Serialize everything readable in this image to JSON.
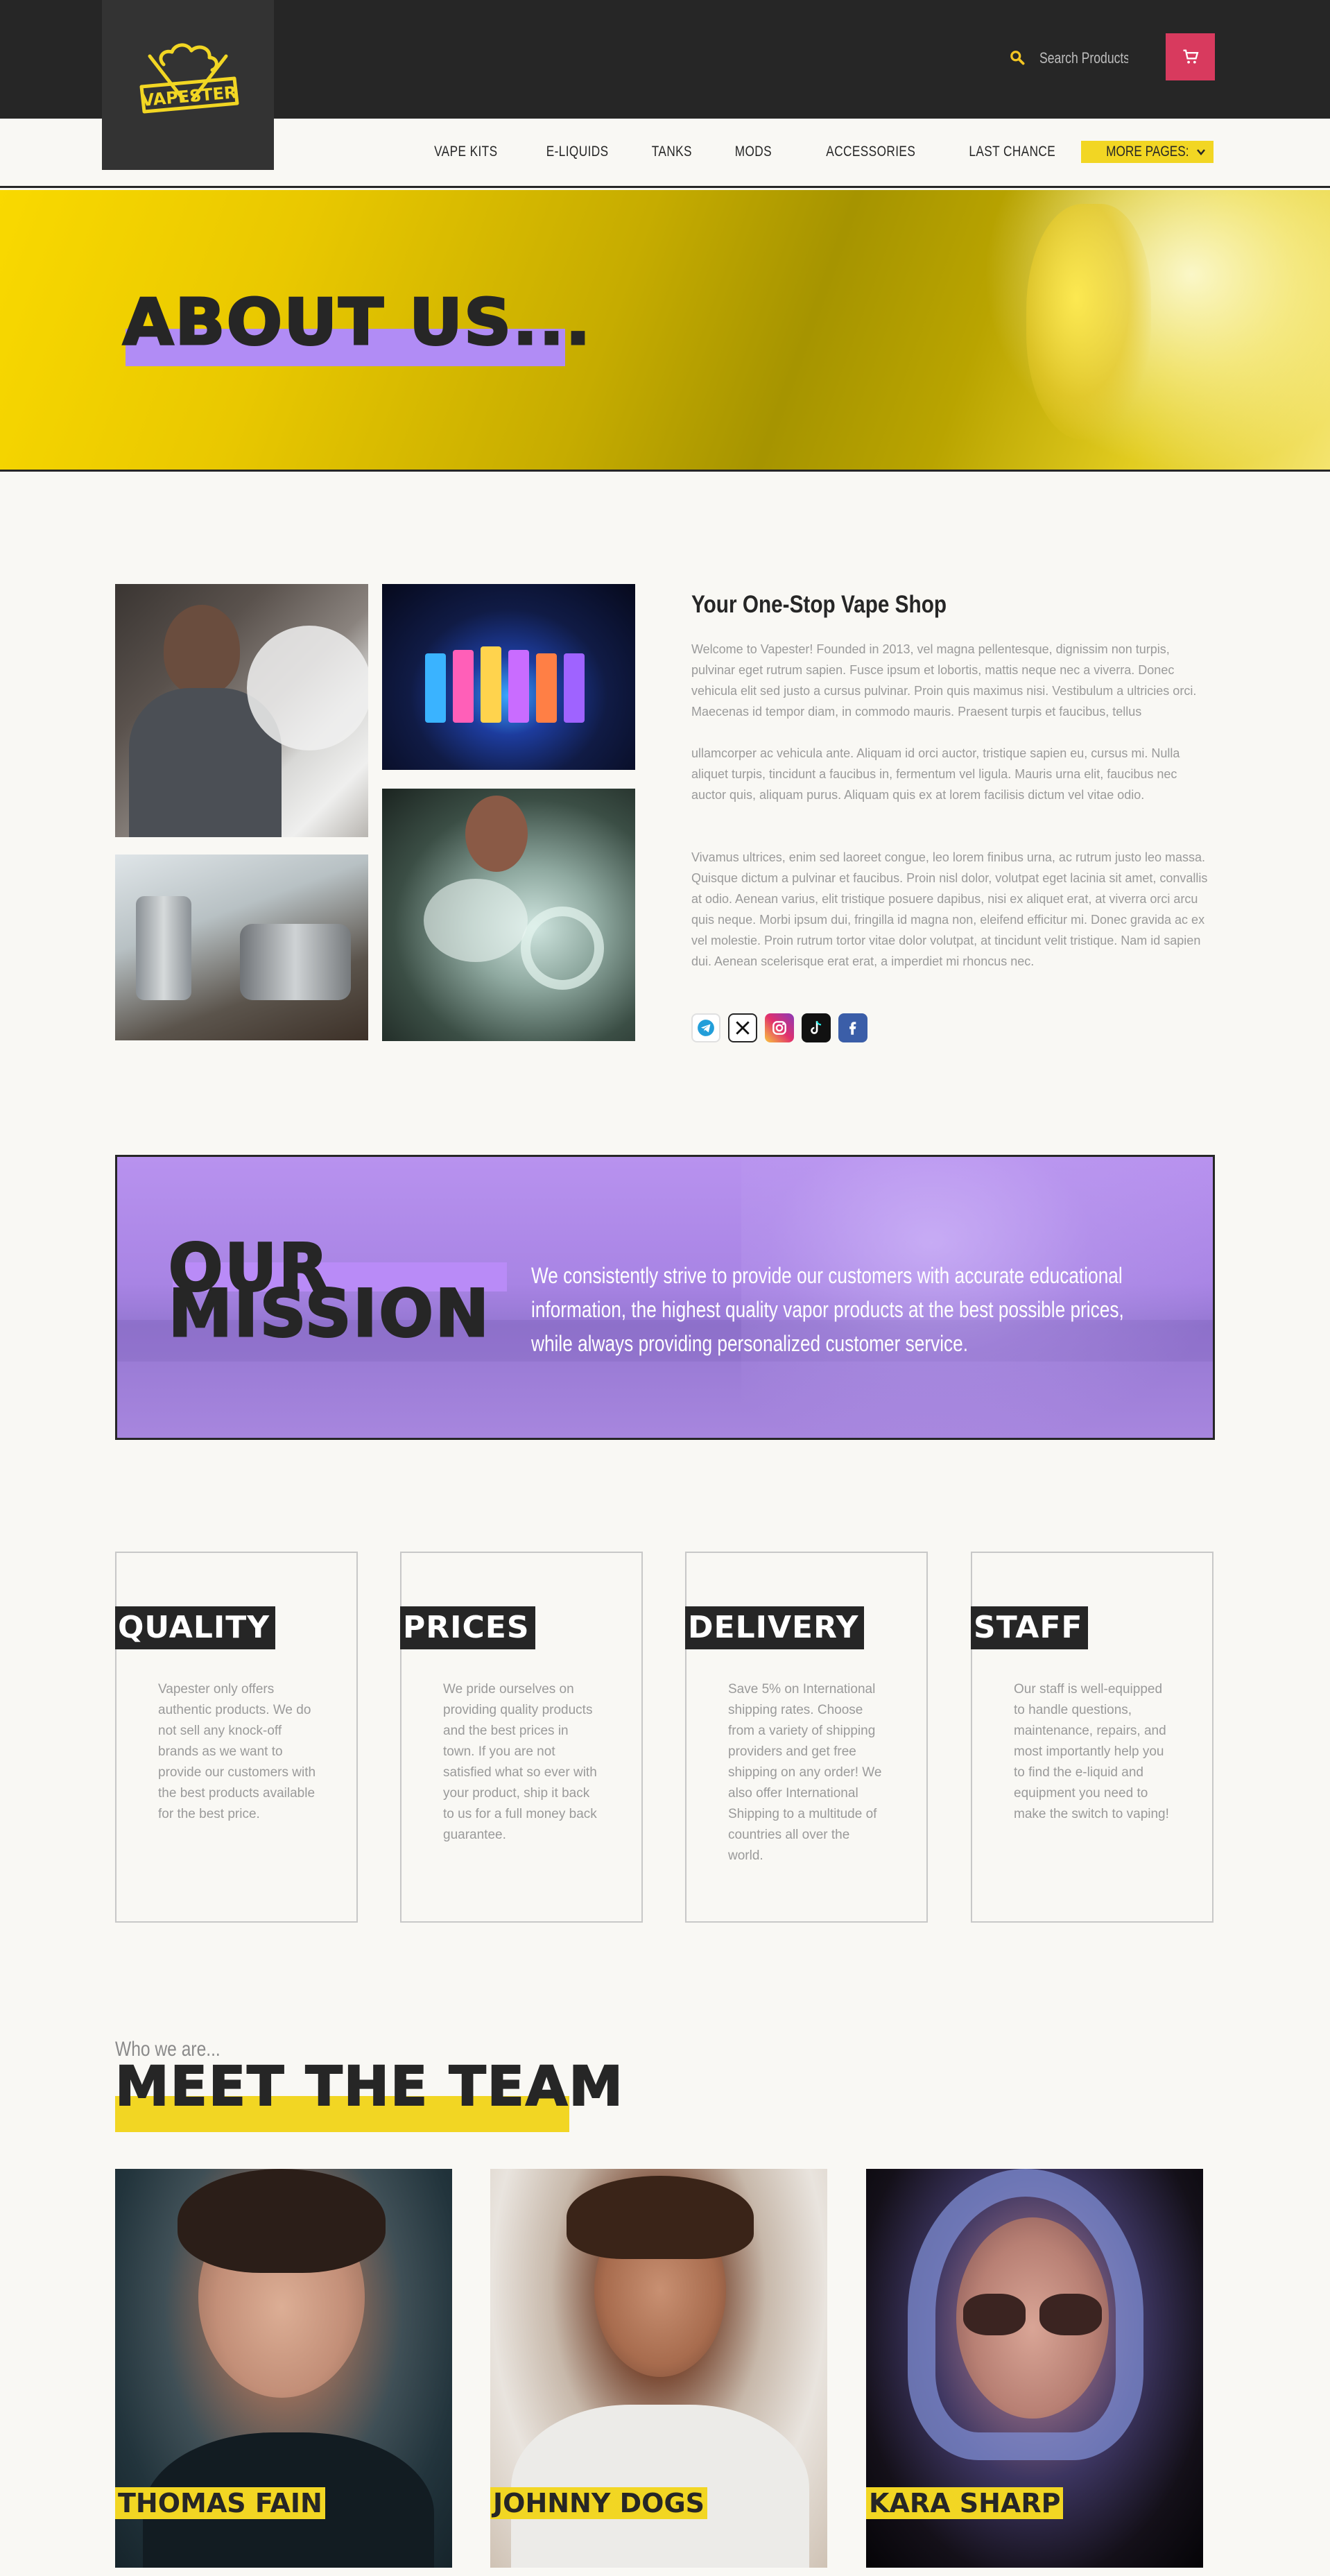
{
  "header": {
    "logo_text": "VAPESTER",
    "search": {
      "placeholder": "Search Products..."
    },
    "colors": {
      "topbar": "#262626",
      "accent_yellow": "#f2d623",
      "cart_pink": "#d83a5e",
      "accent_purple": "#b18cf5"
    }
  },
  "nav": {
    "items": [
      {
        "label": "VAPE KITS"
      },
      {
        "label": "E-LIQUIDS"
      },
      {
        "label": "TANKS"
      },
      {
        "label": "MODS"
      },
      {
        "label": "ACCESSORIES"
      },
      {
        "label": "LAST CHANCE"
      }
    ],
    "more_label": "MORE PAGES:"
  },
  "hero": {
    "title": "ABOUT US..."
  },
  "about": {
    "heading": "Your One-Stop Vape Shop",
    "paragraphs": [
      "Welcome to Vapester! Founded in 2013, vel magna pellentesque, dignissim non turpis, pulvinar eget rutrum sapien. Fusce ipsum et lobortis, mattis neque nec a viverra. Donec vehicula elit sed justo a cursus pulvinar. Proin quis maximus nisi. Vestibulum a ultricies orci. Maecenas id tempor diam, in commodo mauris. Praesent turpis et faucibus, tellus",
      "ullamcorper ac vehicula ante. Aliquam id orci auctor, tristique sapien eu, cursus mi. Nulla aliquet turpis, tincidunt a faucibus in, fermentum vel ligula. Mauris urna elit, faucibus nec auctor quis, aliquam purus. Aliquam quis ex at lorem facilisis dictum vel vitae odio.",
      "Vivamus ultrices, enim sed laoreet congue, leo lorem finibus urna, ac rutrum justo leo massa. Quisque dictum a pulvinar et faucibus. Proin nisl dolor, volutpat eget lacinia sit amet, convallis at odio. Aenean varius, elit tristique posuere dapibus, nisi ex aliquet erat, at viverra orci arcu quis neque. Morbi ipsum dui, fringilla id magna non, eleifend efficitur mi. Donec gravida ac ex vel molestie. Proin rutrum tortor vitae dolor volutpat, at tincidunt velit tristique. Nam id sapien dui. Aenean scelerisque erat erat, a imperdiet mi rhoncus nec."
    ],
    "socials": [
      {
        "icon": "telegram-icon"
      },
      {
        "icon": "x-icon"
      },
      {
        "icon": "instagram-icon"
      },
      {
        "icon": "tiktok-icon"
      },
      {
        "icon": "facebook-icon"
      }
    ]
  },
  "mission": {
    "title_line1": "OUR",
    "title_line2": "MISSION",
    "text": "We consistently strive to provide our customers with accurate educational information, the highest quality vapor products at the best possible prices, while always providing personalized customer service."
  },
  "features": [
    {
      "label": "QUALITY",
      "text": "Vapester only offers authentic products. We do not sell any knock-off brands as we want to provide our customers with the best products available for the best price."
    },
    {
      "label": "PRICES",
      "text": "We pride ourselves on providing quality products and the best prices in town. If you are not satisfied what so ever with your product, ship it back to us for a full money back guarantee."
    },
    {
      "label": "DELIVERY",
      "text": "Save 5% on International shipping rates. Choose from a variety of shipping providers and get free shipping on any order! We also offer International Shipping to a multitude of countries all over the world."
    },
    {
      "label": "STAFF",
      "text": "Our staff is well-equipped to handle questions, maintenance, repairs, and most importantly help you to find the e-liquid and equipment you need to make the switch to vaping!"
    }
  ],
  "team": {
    "eyebrow": "Who we are...",
    "title": "MEET THE TEAM",
    "members": [
      {
        "name": "THOMAS FAIN"
      },
      {
        "name": "JOHNNY DOGS"
      },
      {
        "name": "KARA SHARP"
      }
    ]
  }
}
